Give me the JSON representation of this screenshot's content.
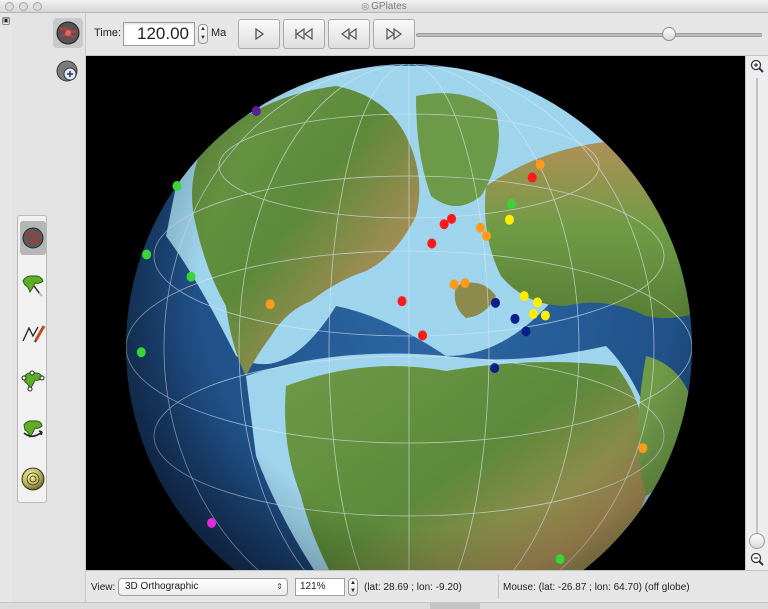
{
  "window": {
    "title": "GPlates"
  },
  "toolbar": {
    "time_label": "Time:",
    "time_value": "120.00",
    "time_unit": "Ma",
    "play_icon": "play-icon",
    "first_frame_icon": "skip-to-start-icon",
    "rewind_icon": "rewind-icon",
    "forward_icon": "fast-forward-icon",
    "timeline_slider_position": 0.73
  },
  "view_tools": [
    {
      "name": "drag-globe-tool",
      "icon": "globe-drag-icon",
      "selected": true
    },
    {
      "name": "zoom-globe-tool",
      "icon": "zoom-globe-icon",
      "selected": false
    }
  ],
  "tool_palette": [
    {
      "name": "choose-feature-tool",
      "icon": "globe-pick-icon",
      "selected": true
    },
    {
      "name": "digitise-polyline-tool",
      "icon": "digitise-polyline-icon",
      "selected": false
    },
    {
      "name": "draw-line-tool",
      "icon": "pen-line-icon",
      "selected": false
    },
    {
      "name": "move-vertex-tool",
      "icon": "move-vertex-icon",
      "selected": false
    },
    {
      "name": "manipulate-pole-tool",
      "icon": "rotate-plate-icon",
      "selected": false
    },
    {
      "name": "small-circle-tool",
      "icon": "small-circle-icon",
      "selected": false
    }
  ],
  "zoom_bar": {
    "slider_position": 0.99
  },
  "status_bar": {
    "view_label": "View:",
    "projection": "3D Orthographic",
    "zoom": "121%",
    "camera_coords": "(lat: 28.69 ; lon: -9.20)",
    "mouse_coords": "Mouse: (lat: -26.87 ; lon: 64.70) (off globe)"
  },
  "colors": {
    "ocean_deep": "#1d4a7e",
    "ocean_shelf": "#9ed4ec",
    "land_low": "#5e8f3e",
    "land_high": "#b3945f",
    "window_bg": "#e6e6e6",
    "marker_red": "#ff1a1a",
    "marker_orange": "#ff9a1a",
    "marker_yellow": "#ffee00",
    "marker_green": "#38d438",
    "marker_blue": "#0a1f8a",
    "marker_purple": "#5a1f9a",
    "marker_magenta": "#e02adc"
  },
  "markers": [
    {
      "color": "#5a1f9a",
      "lon": -128,
      "lat": 52
    },
    {
      "color": "#38d438",
      "lon": -114,
      "lat": 32
    },
    {
      "color": "#38d438",
      "lon": -99,
      "lat": 22
    },
    {
      "color": "#38d438",
      "lon": -82,
      "lat": 8
    },
    {
      "color": "#38d438",
      "lon": -72,
      "lat": 30
    },
    {
      "color": "#ff9a1a",
      "lon": -45,
      "lat": 33
    },
    {
      "color": "#ff1a1a",
      "lon": -11,
      "lat": 38
    },
    {
      "color": "#ff1a1a",
      "lon": -6,
      "lat": 31
    },
    {
      "color": "#ff1a1a",
      "lon": -2,
      "lat": 50
    },
    {
      "color": "#ff1a1a",
      "lon": 3,
      "lat": 54
    },
    {
      "color": "#ff1a1a",
      "lon": 6,
      "lat": 55
    },
    {
      "color": "#ff9a1a",
      "lon": 3,
      "lat": 41
    },
    {
      "color": "#ff9a1a",
      "lon": 6,
      "lat": 41
    },
    {
      "color": "#ff9a1a",
      "lon": 15,
      "lat": 52
    },
    {
      "color": "#ff9a1a",
      "lon": 16,
      "lat": 50
    },
    {
      "color": "#38d438",
      "lon": 30,
      "lat": 55
    },
    {
      "color": "#ffee00",
      "lon": 26,
      "lat": 52
    },
    {
      "color": "#ff1a1a",
      "lon": 46,
      "lat": 58
    },
    {
      "color": "#ff9a1a",
      "lon": 55,
      "lat": 59
    },
    {
      "color": "#0a1f8a",
      "lon": 13,
      "lat": 36
    },
    {
      "color": "#0a1f8a",
      "lon": 17,
      "lat": 32
    },
    {
      "color": "#0a1f8a",
      "lon": 19,
      "lat": 29
    },
    {
      "color": "#0a1f8a",
      "lon": 10,
      "lat": 23
    },
    {
      "color": "#ffee00",
      "lon": 21,
      "lat": 36
    },
    {
      "color": "#ffee00",
      "lon": 24,
      "lat": 34
    },
    {
      "color": "#ffee00",
      "lon": 22,
      "lat": 32
    },
    {
      "color": "#ffee00",
      "lon": 25,
      "lat": 31
    },
    {
      "color": "#ff9a1a",
      "lon": 47,
      "lat": -6
    },
    {
      "color": "#e02adc",
      "lon": -58,
      "lat": -22
    },
    {
      "color": "#38d438",
      "lon": 28,
      "lat": -28
    }
  ]
}
